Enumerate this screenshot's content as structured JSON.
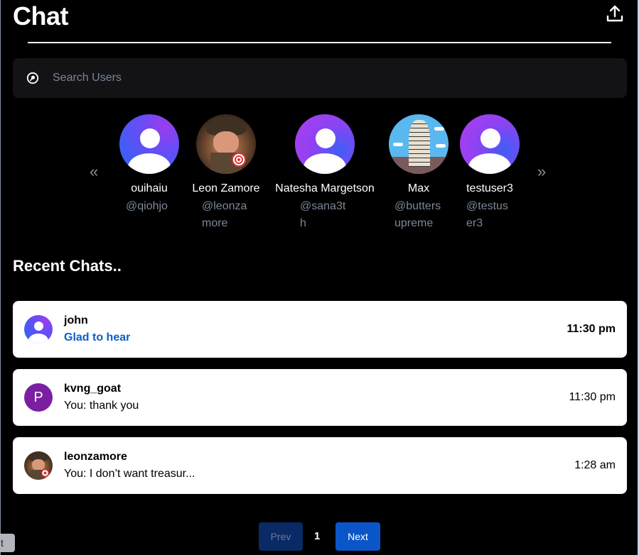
{
  "header": {
    "title": "Chat",
    "share_icon": "upload-share-icon"
  },
  "search": {
    "placeholder": "Search Users",
    "value": "",
    "icon": "search-icon"
  },
  "carousel": {
    "prev_icon": "«",
    "next_icon": "»",
    "users": [
      {
        "name": "ouihaiu",
        "handle": "@qiohjo",
        "avatar": "default-gradient"
      },
      {
        "name": "Leon Zamore",
        "handle": "@leonzamore",
        "avatar": "photo"
      },
      {
        "name": "Natesha Margetson",
        "handle": "@sana3th",
        "avatar": "default-gradient"
      },
      {
        "name": "Max",
        "handle": "@buttersupreme",
        "avatar": "photo"
      },
      {
        "name": "testuser3",
        "handle": "@testuser3",
        "avatar": "default-gradient"
      }
    ]
  },
  "recent": {
    "title": "Recent Chats..",
    "chats": [
      {
        "name": "john",
        "message": "Glad to hear",
        "time": "11:30 pm",
        "unread": true,
        "avatar": "default-gradient"
      },
      {
        "name": "kvng_goat",
        "message": "You: thank you",
        "time": "11:30 pm",
        "unread": false,
        "avatar": "letter",
        "initial": "P",
        "avatar_color": "#7b1fa2"
      },
      {
        "name": "leonzamore",
        "message": "You: I don’t want treasur...",
        "time": "1:28 am",
        "unread": false,
        "avatar": "photo"
      }
    ]
  },
  "pagination": {
    "prev_label": "Prev",
    "current_page": "1",
    "next_label": "Next"
  },
  "tooltip": {
    "text": "t"
  },
  "colors": {
    "background": "#000000",
    "accent": "#0a56c9",
    "unread_message": "#0a5fc9",
    "muted_text": "#7b8798"
  }
}
